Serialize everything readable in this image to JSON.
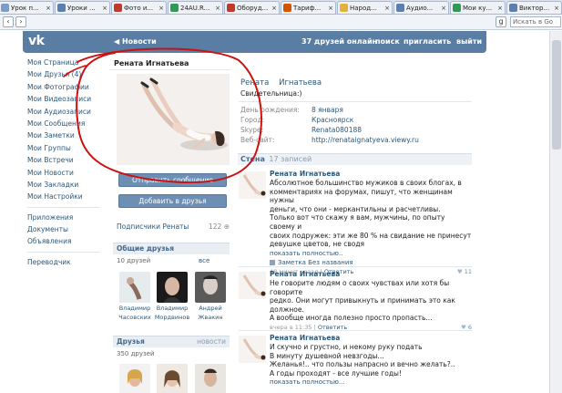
{
  "browser": {
    "tabs": [
      {
        "title": "Урок п...",
        "color": "#7a9cc7"
      },
      {
        "title": "Уроки ...",
        "color": "#5a7fb0"
      },
      {
        "title": "Фото и...",
        "color": "#c0392b"
      },
      {
        "title": "24AU.R...",
        "color": "#2f9a57"
      },
      {
        "title": "Оборуд...",
        "color": "#c0392b"
      },
      {
        "title": "Тариф...",
        "color": "#d35400"
      },
      {
        "title": "Народ...",
        "color": "#e3b23c"
      },
      {
        "title": "Аудио...",
        "color": "#5a7fb0"
      },
      {
        "title": "Мои ку...",
        "color": "#2f9a57"
      },
      {
        "title": "Виктор...",
        "color": "#5a7fb0"
      }
    ],
    "search_placeholder": "Искать в Go"
  },
  "header": {
    "logo": "vk",
    "back_label": "◀ Новости",
    "friends_online": "37 друзей онлайн",
    "search": "поиск",
    "invite": "пригласить",
    "logout": "выйти"
  },
  "nav": {
    "items": [
      "Моя Страница",
      "Мои Друзья (4)",
      "Мои Фотографии",
      "Мои Видеозаписи",
      "Мои Аудиозаписи",
      "Мои Сообщения",
      "Мои Заметки",
      "Мои Группы",
      "Мои Встречи",
      "Мои Новости",
      "Мои Закладки",
      "Мои Настройки"
    ],
    "items2": [
      "Приложения",
      "Документы",
      "Объявления"
    ],
    "items3": [
      "Переводчик"
    ]
  },
  "profile": {
    "name": "Рената Игнатьева",
    "first_name": "Рената",
    "last_name": "Игнатьева",
    "status": "Свидетельница:)",
    "send_message": "Отправить сообщение",
    "add_friend": "Добавить в друзья",
    "subscribers_label": "Подписчики Ренаты",
    "subscribers_count": "122",
    "info": [
      {
        "key": "День рождения:",
        "value": "8 января"
      },
      {
        "key": "Город:",
        "value": "Красноярск"
      },
      {
        "key": "Skype:",
        "value": "Renata080188"
      },
      {
        "key": "Веб-сайт:",
        "value": "http://renataignatyeva.viewy.ru"
      }
    ]
  },
  "common_friends": {
    "title": "Общие друзья",
    "count": "10 друзей",
    "all": "все",
    "people": [
      {
        "first": "Владимир",
        "last": "Часовских"
      },
      {
        "first": "Владимир",
        "last": "Мордвинов"
      },
      {
        "first": "Андрей",
        "last": "Жвакин"
      }
    ]
  },
  "friends": {
    "title": "Друзья",
    "right": "новости",
    "count": "350 друзей"
  },
  "wall": {
    "title": "Стена",
    "count": "17 записей",
    "posts": [
      {
        "author": "Рената Игнатьева",
        "text": "Абсолютное большинство мужиков в своих блогах, в\nкомментариях на форумах, пишут, что женщинам нужны\nденьги, что они - меркантильны и расчетливы.\nТолько вот что скажу я вам, мужчины, по опыту своему и\nсвоих подружек: эти же 80 % на свидание не принесут\nдевушке цветов, не сводя",
        "more": "показать полностью..",
        "note": "Заметка Без названия",
        "time": "48 минут назад",
        "reply": "Ответить",
        "likes": "11"
      },
      {
        "author": "Рената Игнатьева",
        "text": "Не говорите людям о своих чувствах или хотя бы говорите\nредко. Они могут привыкнуть и принимать это как должное.\nА вообще иногда полезно просто пропасть...",
        "time": "вчера в 11:35",
        "reply": "Ответить",
        "likes": "6"
      },
      {
        "author": "Рената Игнатьева",
        "text": "И скучно и грустно, и некому руку подать\nВ минуту душевной невзгоды...\nЖеланья!.. что пользы напрасно и вечно желать?..\nА годы проходят - все лучшие годы!",
        "more": "показать полностью..."
      }
    ]
  },
  "annotation": {
    "color": "#cc1111"
  }
}
